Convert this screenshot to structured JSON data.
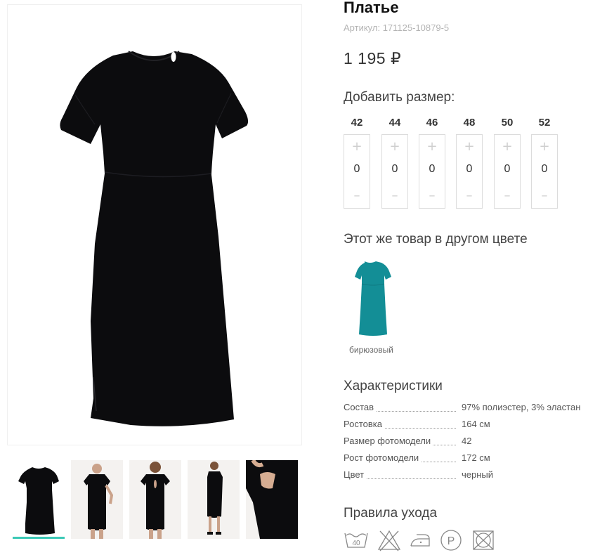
{
  "product": {
    "title": "Платье",
    "sku_label": "Артикул:",
    "sku_value": "171125-10879-5",
    "price": "1 195 ₽"
  },
  "sizes_section": {
    "heading": "Добавить размер:",
    "sizes": [
      {
        "label": "42",
        "qty": "0"
      },
      {
        "label": "44",
        "qty": "0"
      },
      {
        "label": "46",
        "qty": "0"
      },
      {
        "label": "48",
        "qty": "0"
      },
      {
        "label": "50",
        "qty": "0"
      },
      {
        "label": "52",
        "qty": "0"
      }
    ],
    "plus_glyph": "+",
    "minus_glyph": "–"
  },
  "colors_section": {
    "heading": "Этот же товар в другом цвете",
    "variants": [
      {
        "label": "бирюзовый",
        "swatch": "#138e96"
      }
    ]
  },
  "specs_section": {
    "heading": "Характеристики",
    "rows": [
      {
        "key": "Состав",
        "value": "97% полиэстер, 3% эластан"
      },
      {
        "key": "Ростовка",
        "value": "164 см"
      },
      {
        "key": "Размер фотомодели",
        "value": "42"
      },
      {
        "key": "Рост фотомодели",
        "value": "172 см"
      },
      {
        "key": "Цвет",
        "value": "черный"
      }
    ]
  },
  "care_section": {
    "heading": "Правила ухода",
    "icons": [
      "wash-40-icon",
      "no-bleach-icon",
      "iron-low-icon",
      "dry-clean-p-icon",
      "no-tumble-dry-icon"
    ],
    "wash_temp": "40",
    "dry_clean_letter": "P"
  },
  "gallery": {
    "thumbnails": [
      "thumb-front",
      "thumb-model-front",
      "thumb-model-back",
      "thumb-model-full",
      "thumb-model-shoulder"
    ],
    "active_index": 0
  },
  "colors": {
    "accent": "#3cc9b6",
    "dress": "#0c0c0e",
    "teal_dress": "#138e96"
  }
}
